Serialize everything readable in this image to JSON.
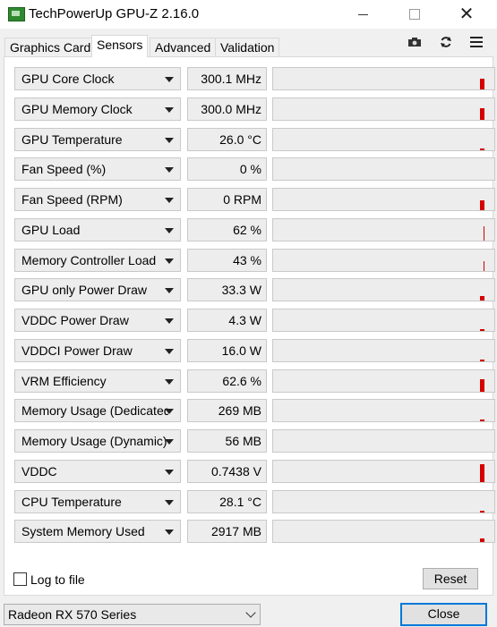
{
  "window": {
    "title": "TechPowerUp GPU-Z 2.16.0"
  },
  "tabs": [
    {
      "label": "Graphics Card"
    },
    {
      "label": "Sensors"
    },
    {
      "label": "Advanced"
    },
    {
      "label": "Validation"
    }
  ],
  "toolbar": {
    "icons": [
      "camera-icon",
      "refresh-icon",
      "menu-icon"
    ]
  },
  "sensors": [
    {
      "name": "GPU Core Clock",
      "value": "300.1 MHz"
    },
    {
      "name": "GPU Memory Clock",
      "value": "300.0 MHz"
    },
    {
      "name": "GPU Temperature",
      "value": "26.0 °C"
    },
    {
      "name": "Fan Speed (%)",
      "value": "0 %"
    },
    {
      "name": "Fan Speed (RPM)",
      "value": "0 RPM"
    },
    {
      "name": "GPU Load",
      "value": "62 %"
    },
    {
      "name": "Memory Controller Load",
      "value": "43 %"
    },
    {
      "name": "GPU only Power Draw",
      "value": "33.3 W"
    },
    {
      "name": "VDDC Power Draw",
      "value": "4.3 W"
    },
    {
      "name": "VDDCI Power Draw",
      "value": "16.0 W"
    },
    {
      "name": "VRM Efficiency",
      "value": "62.6 %"
    },
    {
      "name": "Memory Usage (Dedicated)",
      "value": "269 MB"
    },
    {
      "name": "Memory Usage (Dynamic)",
      "value": "56 MB"
    },
    {
      "name": "VDDC",
      "value": "0.7438 V"
    },
    {
      "name": "CPU Temperature",
      "value": "28.1 °C"
    },
    {
      "name": "System Memory Used",
      "value": "2917 MB"
    }
  ],
  "footer": {
    "log_label": "Log to file",
    "reset_label": "Reset",
    "gpu_selected": "Radeon RX 570 Series",
    "close_label": "Close"
  },
  "colors": {
    "graph_bar": "#d40000",
    "accent": "#0078d7"
  }
}
